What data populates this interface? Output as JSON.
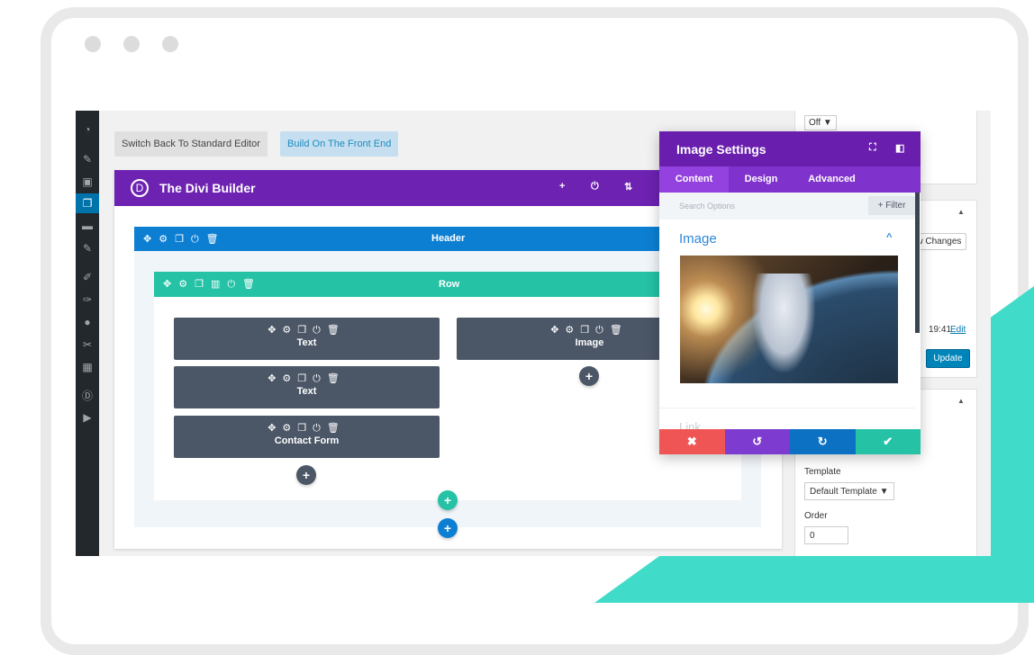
{
  "window": {
    "dots": 3
  },
  "editor": {
    "switch_button": "Switch Back To Standard Editor",
    "frontend_button": "Build On The Front End"
  },
  "builder": {
    "logo": "D",
    "title": "The Divi Builder",
    "toolbar_icons": [
      "plus-icon",
      "power-icon",
      "sort-icon"
    ]
  },
  "section": {
    "label": "Header"
  },
  "row": {
    "label": "Row"
  },
  "modules": {
    "text1": "Text",
    "text2": "Text",
    "contact": "Contact Form",
    "image": "Image"
  },
  "panel": {
    "title": "Image Settings",
    "tabs": [
      "Content",
      "Design",
      "Advanced"
    ],
    "active_tab": "Content",
    "search_placeholder": "Search Options",
    "filter": "+ Filter",
    "group_title": "Image",
    "next_group": "Link"
  },
  "sidebar": {
    "status_select": "Off",
    "preview_button": "Preview Changes",
    "time": "19:41",
    "edit_link": "Edit",
    "update_button": "Update",
    "template_label": "Template",
    "template_value": "Default Template",
    "order_label": "Order",
    "order_value": "0"
  },
  "colors": {
    "purple": "#6d22b2",
    "blue": "#0c7fd3",
    "teal": "#25c2a6",
    "module": "#4b5666",
    "cancel": "#ef5555",
    "undo": "#7e3bd0",
    "redo": "#0c71c3",
    "save": "#25c2a6"
  }
}
